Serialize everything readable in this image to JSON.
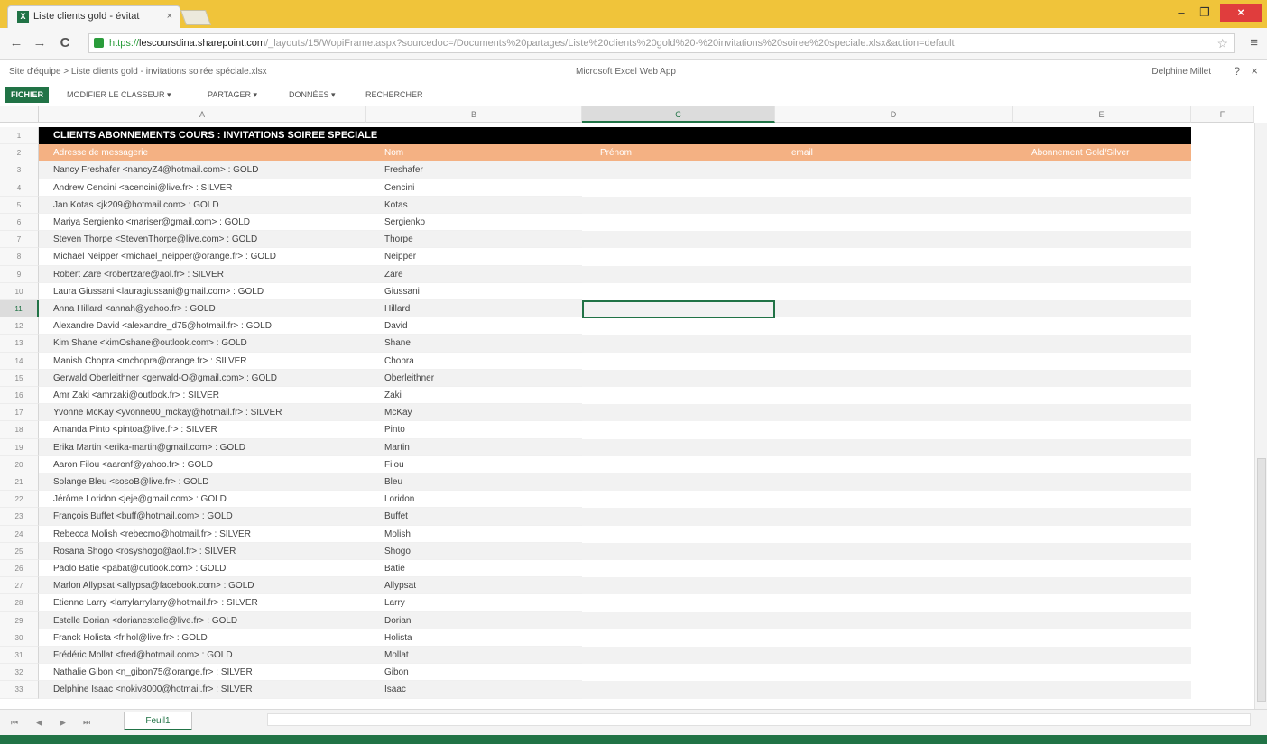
{
  "browser": {
    "tab_title": "Liste clients gold - évitat",
    "tab_close": "×",
    "minimize": "–",
    "maximize": "❐",
    "close": "×",
    "url_scheme": "https://",
    "url_host": "lescoursdina.sharepoint.com",
    "url_path": "/_layouts/15/WopiFrame.aspx?sourcedoc=/Documents%20partages/Liste%20clients%20gold%20-%20invitations%20soiree%20speciale.xlsx&action=default",
    "nav_back": "←",
    "nav_forward": "→",
    "nav_reload": "C",
    "star": "☆",
    "menu": "≡"
  },
  "app": {
    "breadcrumb": "Site d'équipe > Liste clients gold - invitations soirée spéciale.xlsx",
    "name": "Microsoft Excel Web App",
    "user": "Delphine Millet",
    "help": "?",
    "close": "×"
  },
  "ribbon": {
    "file": "FICHIER",
    "tabs": [
      "MODIFIER LE CLASSEUR ▾",
      "PARTAGER ▾",
      "DONNÉES ▾",
      "RECHERCHER"
    ]
  },
  "columns": [
    "A",
    "B",
    "C",
    "D",
    "E",
    "F"
  ],
  "selected_column": "C",
  "selected_row": 11,
  "sheet": {
    "title": "CLIENTS ABONNEMENTS COURS : INVITATIONS SOIREE SPECIALE",
    "headers": [
      "Adresse de messagerie",
      "Nom",
      "Prénom",
      "email",
      "Abonnement Gold/Silver"
    ],
    "rows": [
      {
        "num": "3",
        "a": "Nancy Freshafer <nancyZ4@hotmail.com> : GOLD",
        "b": "Freshafer"
      },
      {
        "num": "4",
        "a": "Andrew Cencini <acencini@live.fr> : SILVER",
        "b": "Cencini"
      },
      {
        "num": "5",
        "a": "Jan Kotas <jk209@hotmail.com> : GOLD",
        "b": "Kotas"
      },
      {
        "num": "6",
        "a": "Mariya Sergienko <mariser@gmail.com> : GOLD",
        "b": "Sergienko"
      },
      {
        "num": "7",
        "a": "Steven Thorpe <StevenThorpe@live.com> : GOLD",
        "b": "Thorpe"
      },
      {
        "num": "8",
        "a": "Michael Neipper <michael_neipper@orange.fr> : GOLD",
        "b": "Neipper"
      },
      {
        "num": "9",
        "a": "Robert Zare <robertzare@aol.fr> : SILVER",
        "b": "Zare"
      },
      {
        "num": "10",
        "a": "Laura Giussani <lauragiussani@gmail.com> : GOLD",
        "b": "Giussani"
      },
      {
        "num": "11",
        "a": "Anna Hillard <annah@yahoo.fr> : GOLD",
        "b": "Hillard"
      },
      {
        "num": "12",
        "a": "Alexandre David <alexandre_d75@hotmail.fr> : GOLD",
        "b": "David"
      },
      {
        "num": "13",
        "a": "Kim Shane <kimOshane@outlook.com> : GOLD",
        "b": "Shane"
      },
      {
        "num": "14",
        "a": "Manish Chopra <mchopra@orange.fr> : SILVER",
        "b": "Chopra"
      },
      {
        "num": "15",
        "a": "Gerwald Oberleithner <gerwald-O@gmail.com> : GOLD",
        "b": "Oberleithner"
      },
      {
        "num": "16",
        "a": "Amr Zaki <amrzaki@outlook.fr> : SILVER",
        "b": "Zaki"
      },
      {
        "num": "17",
        "a": "Yvonne McKay <yvonne00_mckay@hotmail.fr> : SILVER",
        "b": "McKay"
      },
      {
        "num": "18",
        "a": "Amanda Pinto <pintoa@live.fr> : SILVER",
        "b": "Pinto"
      },
      {
        "num": "19",
        "a": "Erika Martin <erika-martin@gmail.com> : GOLD",
        "b": "Martin"
      },
      {
        "num": "20",
        "a": "Aaron Filou <aaronf@yahoo.fr> : GOLD",
        "b": "Filou"
      },
      {
        "num": "21",
        "a": "Solange Bleu <sosoB@live.fr> : GOLD",
        "b": "Bleu"
      },
      {
        "num": "22",
        "a": "Jérôme Loridon <jeje@gmail.com> : GOLD",
        "b": "Loridon"
      },
      {
        "num": "23",
        "a": "François Buffet <buff@hotmail.com> : GOLD",
        "b": "Buffet"
      },
      {
        "num": "24",
        "a": "Rebecca Molish <rebecmo@hotmail.fr> : SILVER",
        "b": "Molish"
      },
      {
        "num": "25",
        "a": "Rosana Shogo <rosyshogo@aol.fr> : SILVER",
        "b": "Shogo"
      },
      {
        "num": "26",
        "a": "Paolo Batie <pabat@outlook.com> : GOLD",
        "b": "Batie"
      },
      {
        "num": "27",
        "a": "Marlon Allypsat <allypsa@facebook.com> : GOLD",
        "b": "Allypsat"
      },
      {
        "num": "28",
        "a": "Etienne Larry <larrylarrylarry@hotmail.fr> : SILVER",
        "b": "Larry"
      },
      {
        "num": "29",
        "a": "Estelle Dorian <dorianestelle@live.fr> : GOLD",
        "b": "Dorian"
      },
      {
        "num": "30",
        "a": "Franck Holista <fr.hol@live.fr> : GOLD",
        "b": "Holista"
      },
      {
        "num": "31",
        "a": "Frédéric Mollat <fred@hotmail.com> : GOLD",
        "b": "Mollat"
      },
      {
        "num": "32",
        "a": "Nathalie Gibon <n_gibon75@orange.fr> : SILVER",
        "b": "Gibon"
      },
      {
        "num": "33",
        "a": "Delphine Isaac <nokiv8000@hotmail.fr> : SILVER",
        "b": "Isaac"
      }
    ]
  },
  "sheetbar": {
    "nav": [
      "⏮",
      "◀",
      "▶",
      "⏭"
    ],
    "sheet_tab": "Feuil1"
  },
  "colors": {
    "excel_green": "#217346",
    "title_bg": "#000000",
    "header_bg": "#f4b183"
  }
}
